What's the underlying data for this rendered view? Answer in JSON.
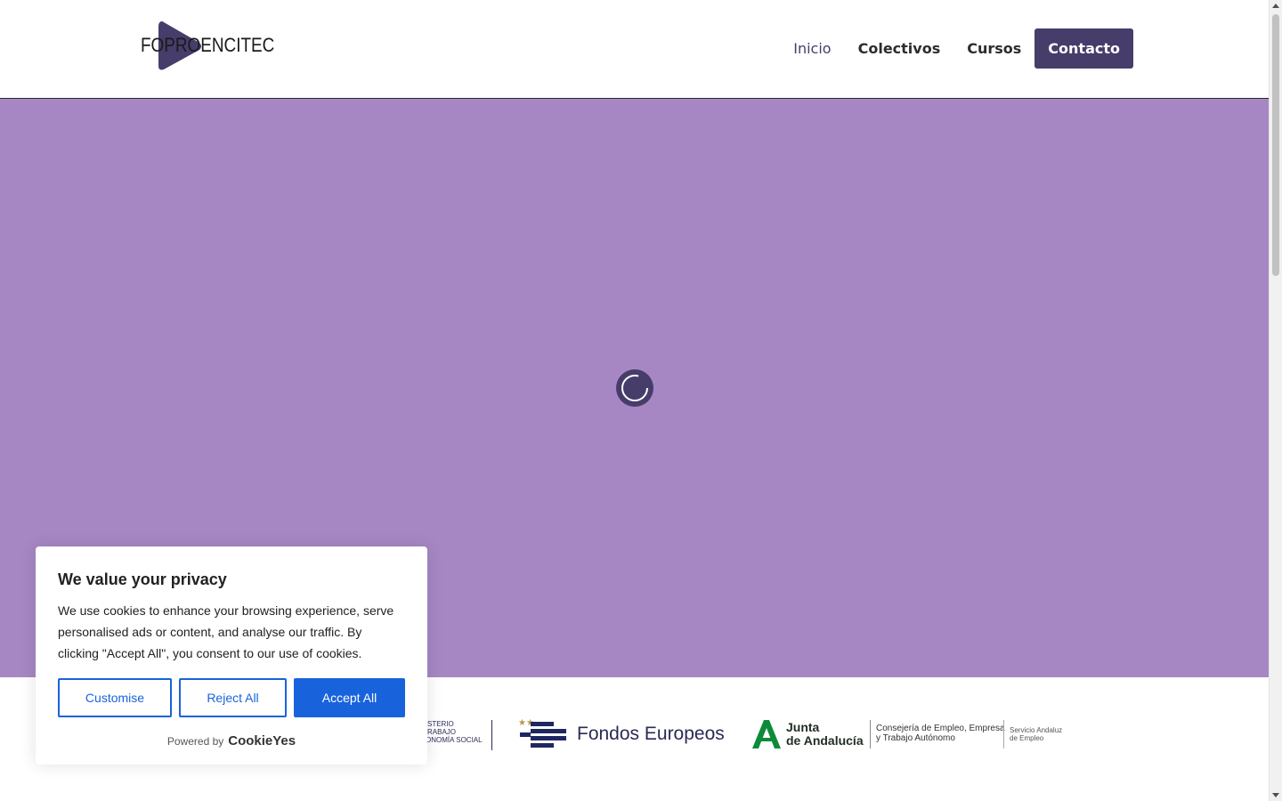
{
  "header": {
    "logo_text": "FOPROENCITEC",
    "nav": [
      {
        "label": "Inicio"
      },
      {
        "label": "Colectivos"
      },
      {
        "label": "Cursos"
      },
      {
        "label": "Contacto"
      }
    ]
  },
  "hero": {
    "background": "#a687c3",
    "spinner_icon": "loading-spinner-icon"
  },
  "logos": {
    "ministerio": {
      "lines": [
        "STERIO",
        "RABAJO",
        "ONOMÍA SOCIAL"
      ]
    },
    "fondos": {
      "text": "Fondos Europeos"
    },
    "junta": {
      "name_line1": "Junta",
      "name_line2": "de Andalucía",
      "consejeria_line1": "Consejería de Empleo, Empresa",
      "consejeria_line2": "y Trabajo Autónomo",
      "sae_line1": "Servicio Andaluz",
      "sae_line2": "de Empleo"
    }
  },
  "cookie": {
    "title": "We value your privacy",
    "text": "We use cookies to enhance your browsing experience, serve personalised ads or content, and analyse our traffic. By clicking \"Accept All\", you consent to our use of cookies.",
    "customise_label": "Customise",
    "reject_label": "Reject All",
    "accept_label": "Accept All",
    "powered_label": "Powered by",
    "powered_brand": "CookieYes",
    "accent": "#1863dc"
  },
  "colors": {
    "brand": "#463d6b"
  }
}
